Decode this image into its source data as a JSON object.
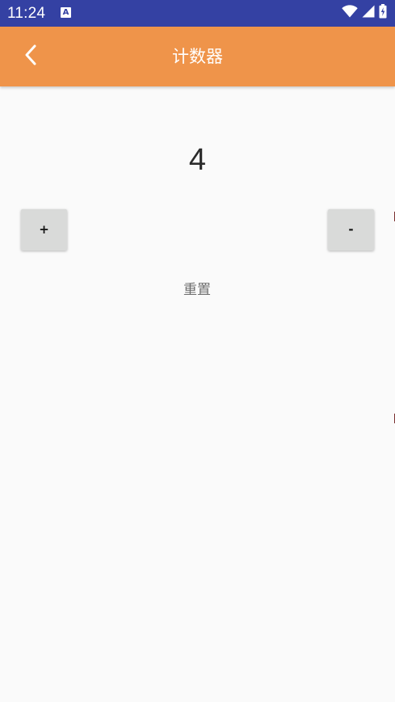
{
  "status_bar": {
    "time": "11:24",
    "notification_icon": "A",
    "icons": [
      "wifi-icon",
      "signal-icon",
      "battery-charging-icon"
    ],
    "background_color": "#3441a3"
  },
  "app_bar": {
    "title": "计数器",
    "back_icon": "chevron-left-icon",
    "background_color": "#ef944a"
  },
  "counter": {
    "value": "4",
    "increment_label": "+",
    "decrement_label": "-",
    "reset_label": "重置"
  }
}
